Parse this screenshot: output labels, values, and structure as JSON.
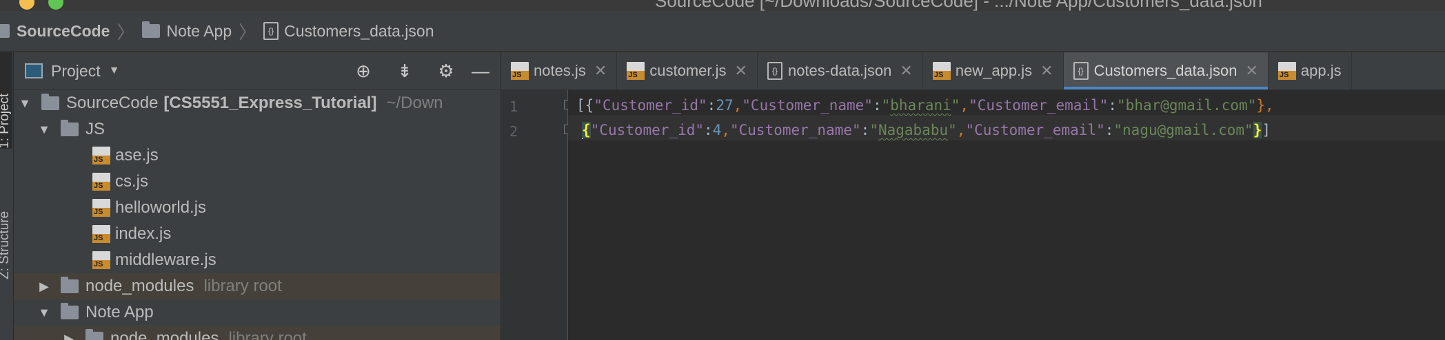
{
  "window": {
    "title": "SourceCode [~/Downloads/SourceCode] - .../Note App/Customers_data.json"
  },
  "breadcrumb": {
    "items": [
      "SourceCode",
      "Note App",
      "Customers_data.json"
    ]
  },
  "toolstrip": {
    "tabs": [
      "1: Project",
      "Z: Structure"
    ]
  },
  "project_panel": {
    "title": "Project",
    "tree": [
      {
        "name": "SourceCode",
        "module": "[CS5551_Express_Tutorial]",
        "path": "~/Down"
      },
      {
        "name": "JS"
      },
      {
        "name": "ase.js"
      },
      {
        "name": "cs.js"
      },
      {
        "name": "helloworld.js"
      },
      {
        "name": "index.js"
      },
      {
        "name": "middleware.js"
      },
      {
        "name": "node_modules",
        "note": "library root"
      },
      {
        "name": "Note App"
      },
      {
        "name": "node_modules",
        "note": "library root"
      }
    ]
  },
  "tabs": [
    {
      "label": "notes.js"
    },
    {
      "label": "customer.js"
    },
    {
      "label": "notes-data.json"
    },
    {
      "label": "new_app.js"
    },
    {
      "label": "Customers_data.json"
    },
    {
      "label": "app.js"
    }
  ],
  "editor": {
    "line_numbers": [
      "1",
      "2"
    ],
    "line1": {
      "t0": "[{",
      "t1": "\"Customer_id\"",
      "t2": ":",
      "t3": "27",
      "t4": ",",
      "t5": "\"Customer_name\"",
      "t6": ":",
      "t7": "\"",
      "t8": "bharani",
      "t9": "\"",
      "t10": ",",
      "t11": "\"Customer_email\"",
      "t12": ":",
      "t13": "\"bhar@gmail.com\"",
      "t14": "},"
    },
    "line2": {
      "t0": "{",
      "t1": "\"Customer_id\"",
      "t2": ":",
      "t3": "4",
      "t4": ",",
      "t5": "\"Customer_name\"",
      "t6": ":",
      "t7": "\"",
      "t8": "Nagababu",
      "t9": "\"",
      "t10": ",",
      "t11": "\"Customer_email\"",
      "t12": ":",
      "t13": "\"nagu@gmail.com\"",
      "t14": "}",
      "t15": "]"
    }
  },
  "colors": {
    "accent": "#4a88c7",
    "key": "#9876aa",
    "string": "#6a8759",
    "number": "#6897bb",
    "highlight_brace": "#ffef28"
  }
}
